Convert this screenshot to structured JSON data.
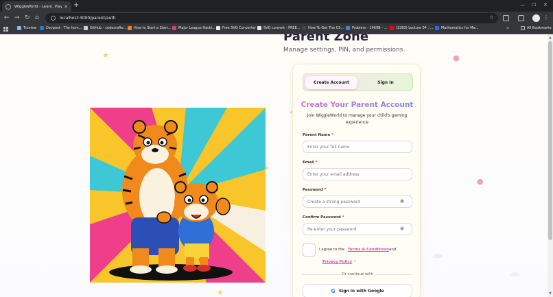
{
  "browser": {
    "tab_title": "WiggleWorld - Learn, Play, Wig...",
    "url": "localhost:3000/parent/auth",
    "bookmarks": [
      {
        "label": "Truview",
        "color": "#8ab4f8"
      },
      {
        "label": "Devpost - The hom...",
        "color": "#1f7bdc"
      },
      {
        "label": "GitHub - codecrafte...",
        "color": "#c9d1d9"
      },
      {
        "label": "How to Start a Start...",
        "color": "#f48024"
      },
      {
        "label": "Major League Hacki...",
        "color": "#d83b7e"
      },
      {
        "label": "Free SVG Converter",
        "color": "#e8eaed"
      },
      {
        "label": "SVG convert - FREE...",
        "color": "#e8eaed"
      },
      {
        "label": "How To Get The CS...",
        "color": "#444"
      },
      {
        "label": "Problem - 1669B - ...",
        "color": "#4a7fd4"
      },
      {
        "label": "(2283) Lecture 04 : ...",
        "color": "#ff0000"
      },
      {
        "label": "Mathematics for Ma...",
        "color": "#1f6feb"
      }
    ],
    "all_bookmarks": "All Bookmarks"
  },
  "page": {
    "heading": "Parent Zone",
    "subheading": "Manage settings, PIN, and permissions."
  },
  "auth": {
    "tabs": {
      "create": "Create Account",
      "signin": "Sign In"
    },
    "title": "Create Your Parent Account",
    "description": "Join WiggleWorld to manage your child's gaming experience",
    "fields": {
      "name_label": "Parent Name",
      "name_placeholder": "Enter your full name",
      "email_label": "Email",
      "email_placeholder": "Enter your email address",
      "password_label": "Password",
      "password_placeholder": "Create a strong password",
      "confirm_label": "Confirm Password",
      "confirm_placeholder": "Re-enter your password",
      "required_mark": "*"
    },
    "agree": {
      "prefix": "I agree to the",
      "terms": "Terms & Conditions",
      "and": "and",
      "privacy": "Privacy Policy",
      "required_mark": "*"
    },
    "divider": "Or continue with",
    "google": "Sign in with Google"
  },
  "colors": {
    "accent_pink": "#e04bb5",
    "accent_green": "#e3f6d8",
    "title_gradient": [
      "#e665c9",
      "#6a8df0"
    ]
  }
}
